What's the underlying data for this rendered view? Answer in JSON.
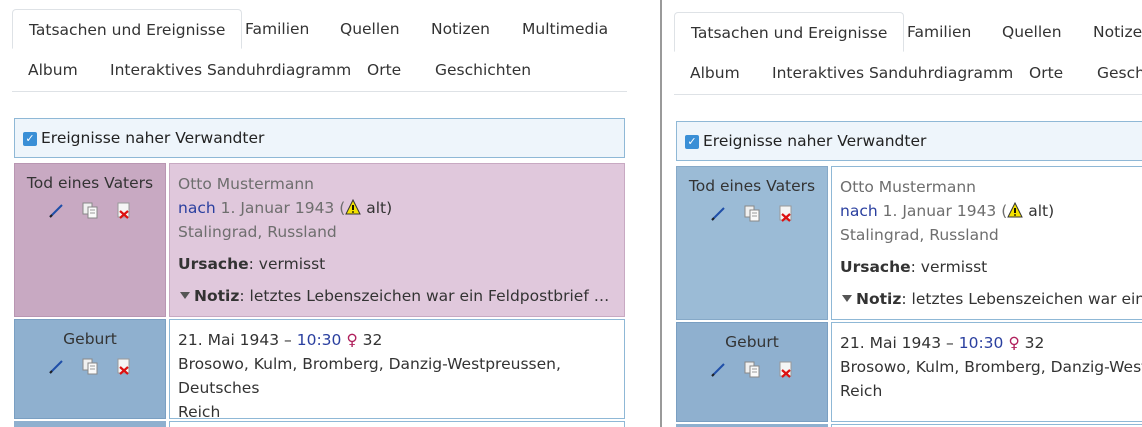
{
  "tabs": {
    "facts": "Tatsachen und Ereignisse",
    "families": "Familien",
    "sources": "Quellen",
    "notes": "Notizen",
    "multimedia": "Multimedia",
    "album": "Album",
    "hourglass": "Interaktives Sanduhrdiagramm",
    "places": "Orte",
    "stories": "Geschichten",
    "notes_truncated": "Notizen",
    "stories_truncated": "Geschi"
  },
  "filter": {
    "label": "Ereignisse naher Verwandter",
    "checked": true
  },
  "events": [
    {
      "label": "Tod eines Vaters",
      "person": "Otto Mustermann",
      "date_qualifier": "nach",
      "date": "1. Januar 1943 (",
      "warning_text": "alt)",
      "place": "Stalingrad, Russland",
      "cause_label": "Ursache",
      "cause_value": ": vermisst",
      "note_label": "Notiz",
      "note_value": ": letztes Lebenszeichen war ein Feldpostbrief vom…",
      "note_value_right": ": letztes Lebenszeichen war ein Fe"
    },
    {
      "label": "Geburt",
      "date": "21. Mai 1943 – ",
      "time": "10:30",
      "sex_symbol": "♀",
      "age": "32",
      "place": "Brosowo, Kulm, Bromberg, Danzig-Westpreussen, Deutsches",
      "place_cont": "Reich",
      "place_right": "Brosowo, Kulm, Bromberg, Danzig-Westpr"
    }
  ],
  "colors": {
    "close_relative_label": "#c8a9c2",
    "close_relative_value": "#e0c8dc",
    "event_label": "#8fb0cf",
    "link": "#2a3f9f"
  },
  "icons": [
    "edit-icon",
    "copy-icon",
    "delete-icon",
    "warning-icon",
    "checkbox-icon",
    "expand-triangle-icon"
  ]
}
